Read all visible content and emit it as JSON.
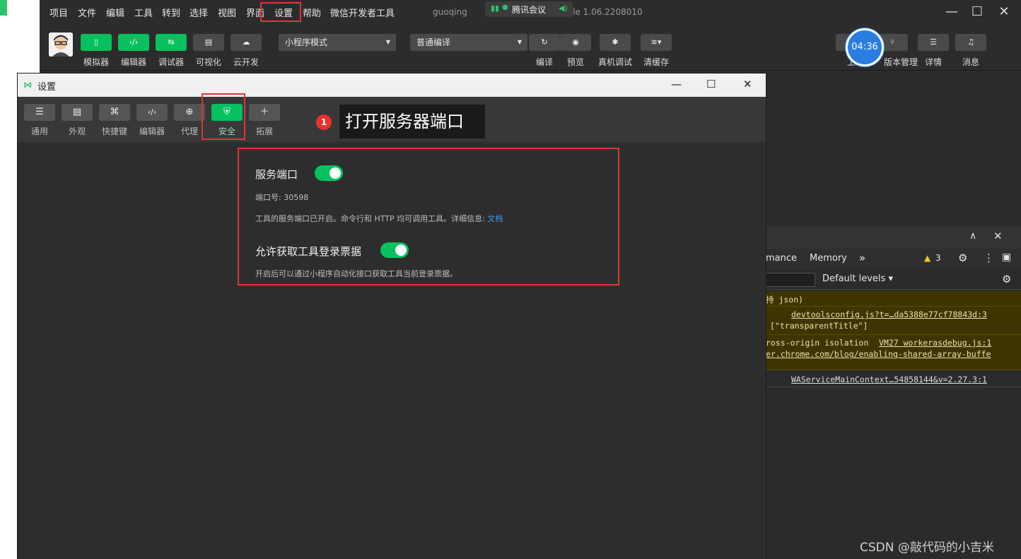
{
  "menubar": {
    "items": [
      "项目",
      "文件",
      "编辑",
      "工具",
      "转到",
      "选择",
      "视图",
      "界面",
      "设置",
      "帮助",
      "微信开发者工具"
    ],
    "title_prefix": "guoqing",
    "title_suffix": "Stable 1.06.2208010",
    "meeting_label": "腾讯会议"
  },
  "toolbar": {
    "left_buttons": [
      {
        "label": "模拟器",
        "icon": "phone-icon"
      },
      {
        "label": "编辑器",
        "icon": "code-icon"
      },
      {
        "label": "调试器",
        "icon": "debug-icon"
      },
      {
        "label": "可视化",
        "icon": "layout-icon"
      },
      {
        "label": "云开发",
        "icon": "cloud-icon"
      }
    ],
    "mode_select": "小程序模式",
    "compile_select": "普通编译",
    "right_buttons": [
      {
        "label": "编译",
        "icon": "refresh-icon"
      },
      {
        "label": "预览",
        "icon": "eye-icon"
      },
      {
        "label": "真机调试",
        "icon": "bug-icon"
      },
      {
        "label": "清缓存",
        "icon": "layers-icon"
      }
    ],
    "far_right": [
      {
        "label": "上",
        "icon": "upload-icon"
      },
      {
        "label": "版本管理",
        "icon": "branch-icon"
      },
      {
        "label": "详情",
        "icon": "menu-icon"
      },
      {
        "label": "消息",
        "icon": "bell-icon"
      }
    ],
    "timer": "04:36"
  },
  "settings": {
    "title": "设置",
    "tabs": [
      {
        "label": "通用",
        "icon": "sliders-icon"
      },
      {
        "label": "外观",
        "icon": "window-icon"
      },
      {
        "label": "快捷键",
        "icon": "command-icon"
      },
      {
        "label": "编辑器",
        "icon": "code-icon"
      },
      {
        "label": "代理",
        "icon": "globe-icon"
      },
      {
        "label": "安全",
        "icon": "shield-icon"
      },
      {
        "label": "拓展",
        "icon": "plus-icon"
      }
    ],
    "active_tab": "安全",
    "service_port": {
      "title": "服务端口",
      "port_line": "端口号: 30598",
      "desc": "工具的服务端口已开启。命令行和 HTTP 均可调用工具。详细信息:",
      "doc_link": "文档",
      "enabled": true
    },
    "login_ticket": {
      "title": "允许获取工具登录票据",
      "desc": "开启后可以通过小程序自动化接口获取工具当前登录票据。",
      "enabled": true
    }
  },
  "callout": {
    "badge": "1",
    "text": "打开服务器端口"
  },
  "devtools": {
    "tabs": [
      "mance",
      "Memory",
      "»"
    ],
    "warning_count": "3",
    "levels": "Default levels",
    "logs": [
      {
        "text": "持 json)",
        "type": "warn"
      },
      {
        "link": "devtoolsconfig.js?t=…da5388e77cf78843d:3",
        "text": "[\"transparentTitle\"]",
        "type": "warn"
      },
      {
        "text": "ross-origin isolation",
        "link": "VM27 workerasdebug.js:1",
        "text2": "er.chrome.com/blog/enabling-shared-array-buffe",
        "type": "warn"
      },
      {
        "link": "WAServiceMainContext…54858144&v=2.27.3:1",
        "type": "info"
      }
    ]
  },
  "watermark": "CSDN @敲代码的小吉米",
  "colors": {
    "accent": "#07c160",
    "highlight": "#e03535",
    "link": "#3b9cff"
  }
}
